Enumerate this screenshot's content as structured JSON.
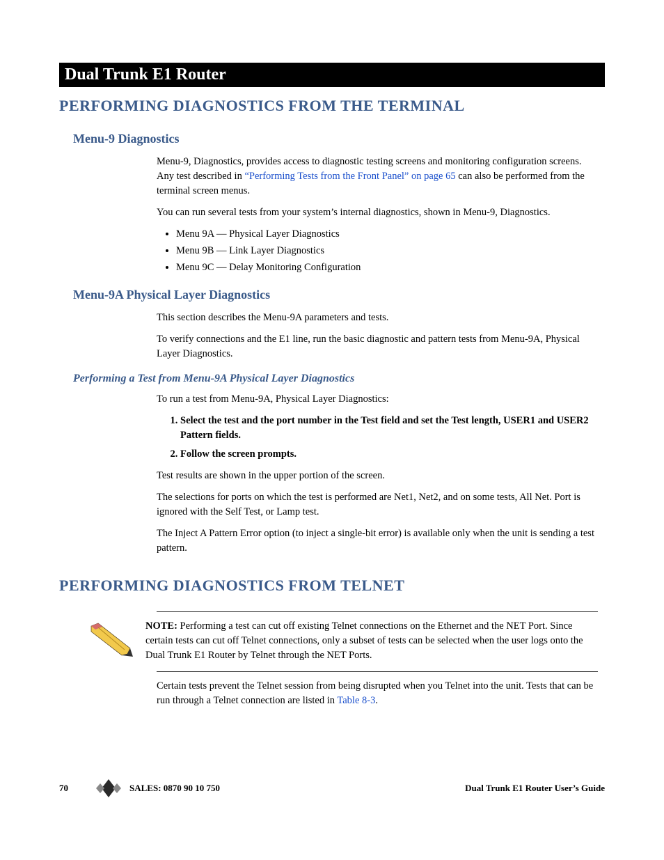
{
  "titleBar": "Dual Trunk E1 Router",
  "section1": {
    "heading": "PERFORMING DIAGNOSTICS FROM THE TERMINAL",
    "sub1": {
      "heading": "Menu-9 Diagnostics",
      "p1a": "Menu-9, Diagnostics, provides access to diagnostic testing screens and monitoring configuration screens. Any test described in ",
      "link1": "“Performing Tests from the Front Panel” on page 65",
      "p1b": " can also be performed from the terminal screen menus.",
      "p2": "You can run several tests from your system’s internal diagnostics, shown in Menu-9, Diagnostics.",
      "bullets": [
        "Menu 9A — Physical Layer Diagnostics",
        "Menu 9B — Link Layer Diagnostics",
        "Menu 9C — Delay Monitoring Configuration"
      ]
    },
    "sub2": {
      "heading": "Menu-9A Physical Layer Diagnostics",
      "p1": "This section describes the Menu-9A parameters and tests.",
      "p2": "To verify connections and the E1 line, run the basic diagnostic and pattern tests from Menu-9A, Physical Layer Diagnostics.",
      "h3": "Performing a Test from Menu-9A Physical Layer Diagnostics",
      "p3": "To run a test from Menu-9A, Physical Layer Diagnostics:",
      "steps": [
        "Select the test and the port number in the Test field and set the Test length, USER1 and USER2 Pattern fields.",
        "Follow the screen prompts."
      ],
      "p4": "Test results are shown in the upper portion of the screen.",
      "p5": "The selections for ports on which the test is performed are Net1, Net2, and on some tests, All Net. Port is ignored with the Self Test,  or Lamp test.",
      "p6": "The Inject A Pattern Error option (to inject a single-bit error) is available only when the unit is sending a test pattern."
    }
  },
  "section2": {
    "heading": "PERFORMING DIAGNOSTICS FROM TELNET",
    "noteLabel": "NOTE: ",
    "note": "Performing a test can cut off existing Telnet connections on the Ethernet and the NET Port. Since certain tests can cut off Telnet connections, only a subset of tests can be selected when the user logs onto the Dual Trunk E1 Router by Telnet through the NET Ports.",
    "p1a": "Certain tests prevent the Telnet session from being disrupted when you Telnet into the unit. Tests that can be run through a Telnet connection are listed in ",
    "link": "Table 8-3",
    "p1b": "."
  },
  "footer": {
    "pageNum": "70",
    "sales": "SALES:  0870 90 10 750",
    "guide": "Dual Trunk E1 Router User’s Guide"
  }
}
